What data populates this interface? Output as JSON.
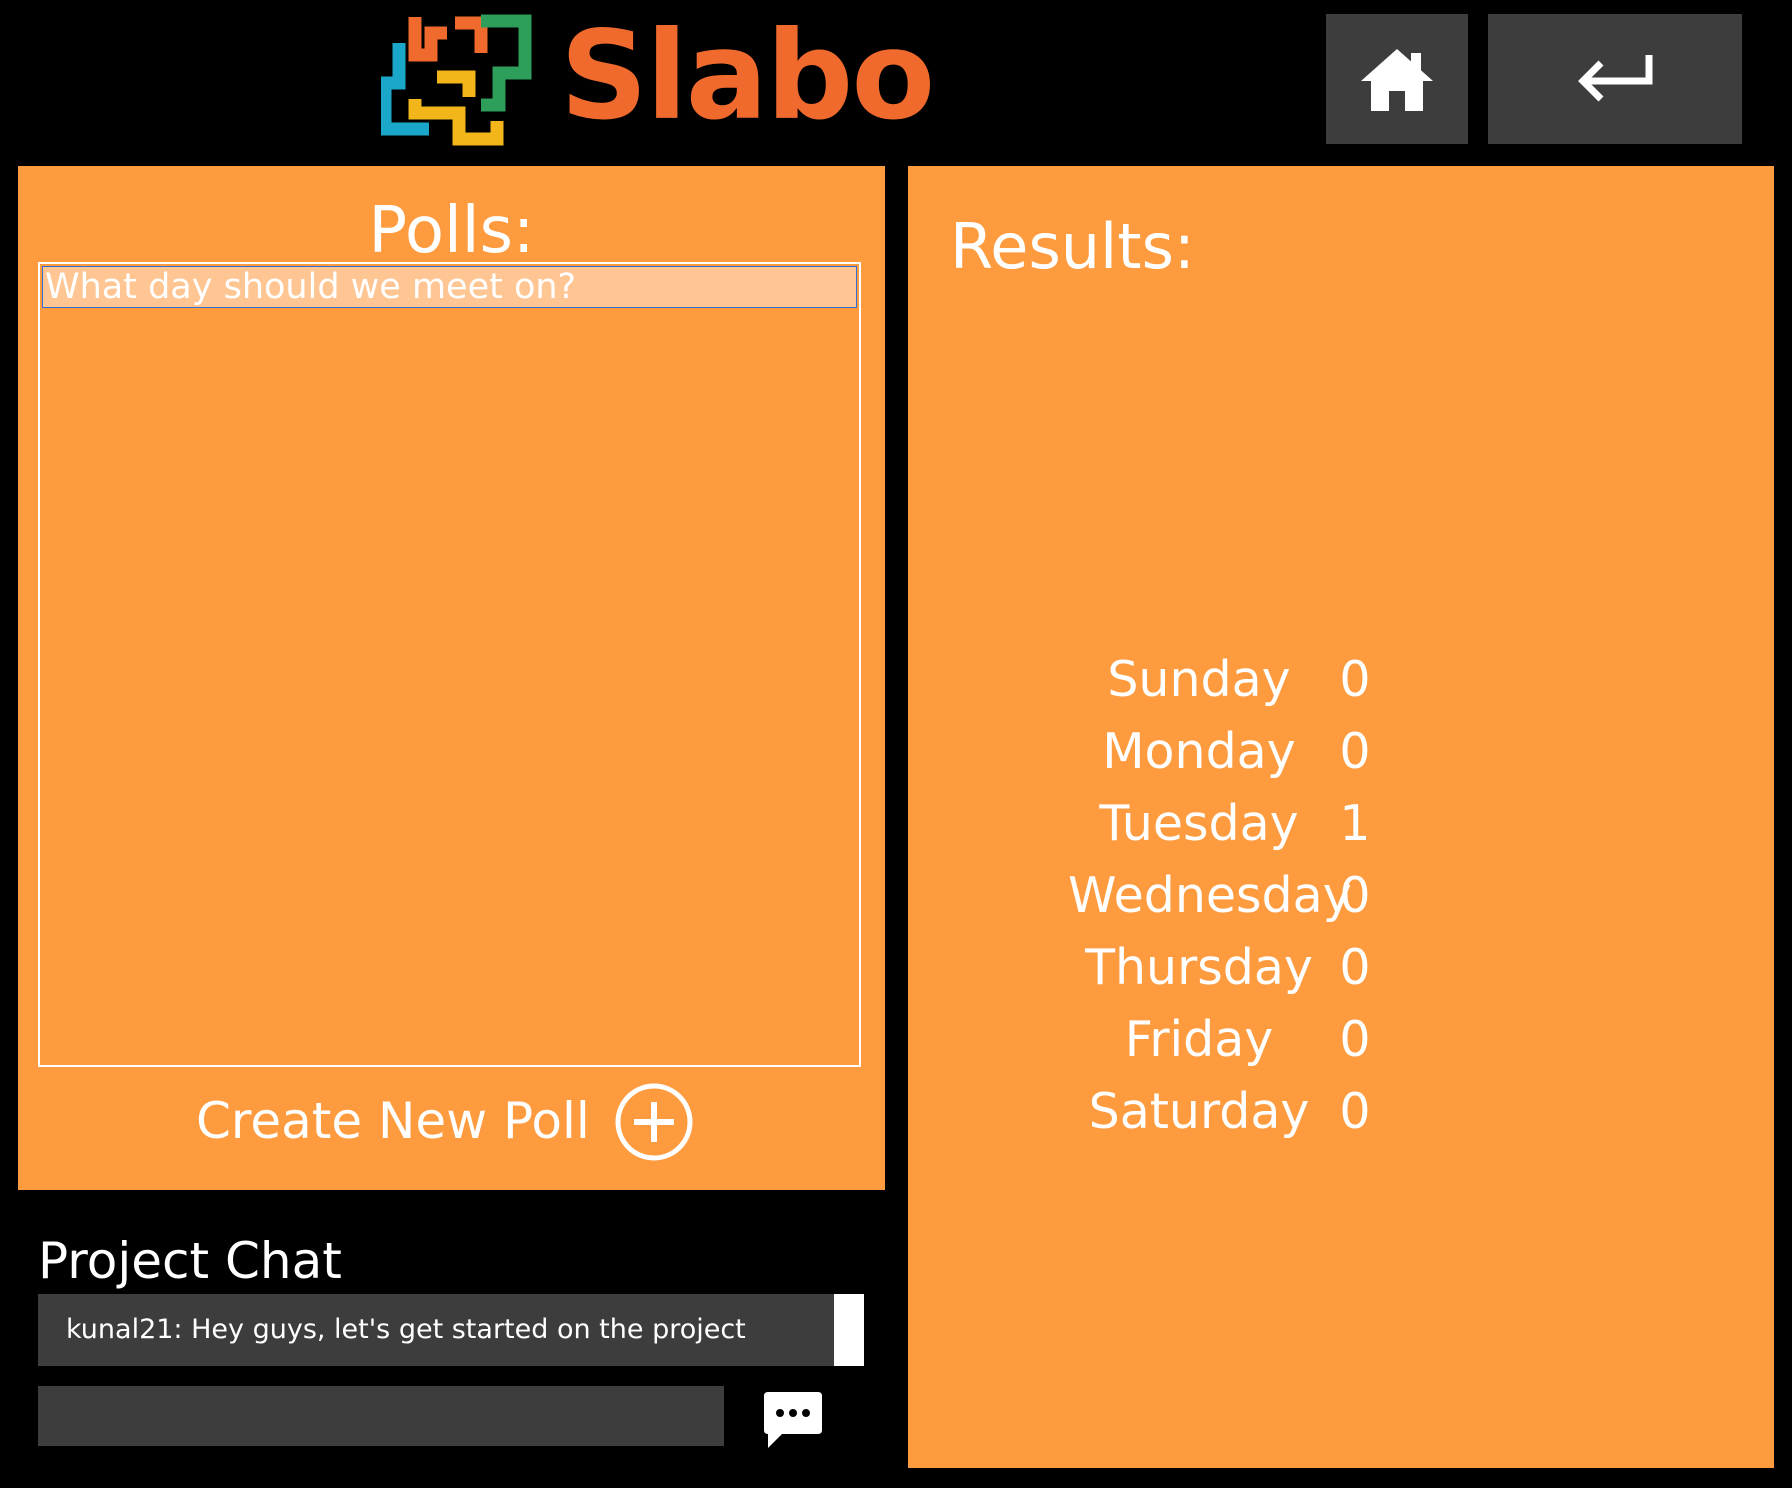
{
  "header": {
    "brand": "Slabo",
    "logo_icon": "slabo-logo-icon",
    "home_icon": "home-icon",
    "back_icon": "return-arrow-icon"
  },
  "polls": {
    "title": "Polls:",
    "items": [
      "What day should we meet on?"
    ],
    "create_label": "Create New Poll",
    "create_icon": "plus-circle-icon"
  },
  "results": {
    "title": "Results:",
    "rows": [
      {
        "day": "Sunday",
        "count": "0"
      },
      {
        "day": "Monday",
        "count": "0"
      },
      {
        "day": "Tuesday",
        "count": "1"
      },
      {
        "day": "Wednesday",
        "count": "0"
      },
      {
        "day": "Thursday",
        "count": "0"
      },
      {
        "day": "Friday",
        "count": "0"
      },
      {
        "day": "Saturday",
        "count": "0"
      }
    ]
  },
  "chat": {
    "title": "Project Chat",
    "messages": [
      {
        "text": "kunal21:  Hey guys, let's get started on the project"
      }
    ],
    "input_value": "",
    "send_icon": "chat-bubble-icon"
  },
  "colors": {
    "background": "#000000",
    "panel": "#ff9b3f",
    "brand": "#ef6a2c",
    "button_dark": "#3d3d3d",
    "selection": "#ffc592"
  }
}
